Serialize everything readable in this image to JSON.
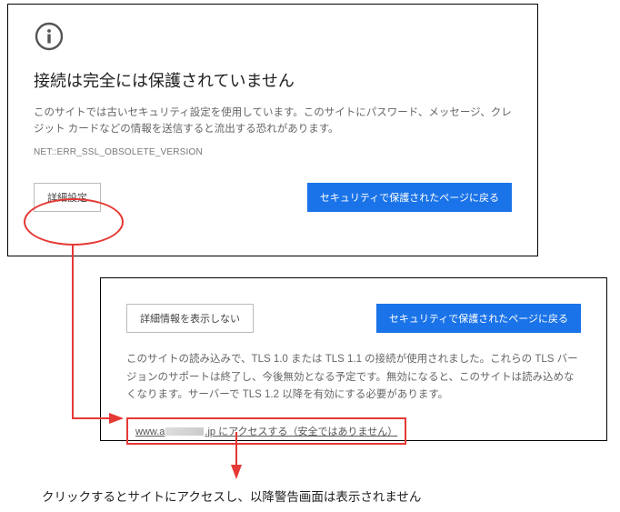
{
  "panel1": {
    "title": "接続は完全には保護されていません",
    "desc": "このサイトでは古いセキュリティ設定を使用しています。このサイトにパスワード、メッセージ、クレジット カードなどの情報を送信すると流出する恐れがあります。",
    "error_code": "NET::ERR_SSL_OBSOLETE_VERSION",
    "details_btn": "詳細設定",
    "back_btn": "セキュリティで保護されたページに戻る"
  },
  "panel2": {
    "hide_btn": "詳細情報を表示しない",
    "back_btn": "セキュリティで保護されたページに戻る",
    "desc": "このサイトの読み込みで、TLS 1.0 または TLS 1.1 の接続が使用されました。これらの TLS バージョンのサポートは終了し、今後無効となる予定です。無効になると、このサイトは読み込めなくなります。サーバーで TLS 1.2 以降を有効にする必要があります。",
    "proceed_prefix": "www.a",
    "proceed_suffix": ".jp にアクセスする（安全ではありません）"
  },
  "caption": "クリックするとサイトにアクセスし、以降警告画面は表示されません"
}
